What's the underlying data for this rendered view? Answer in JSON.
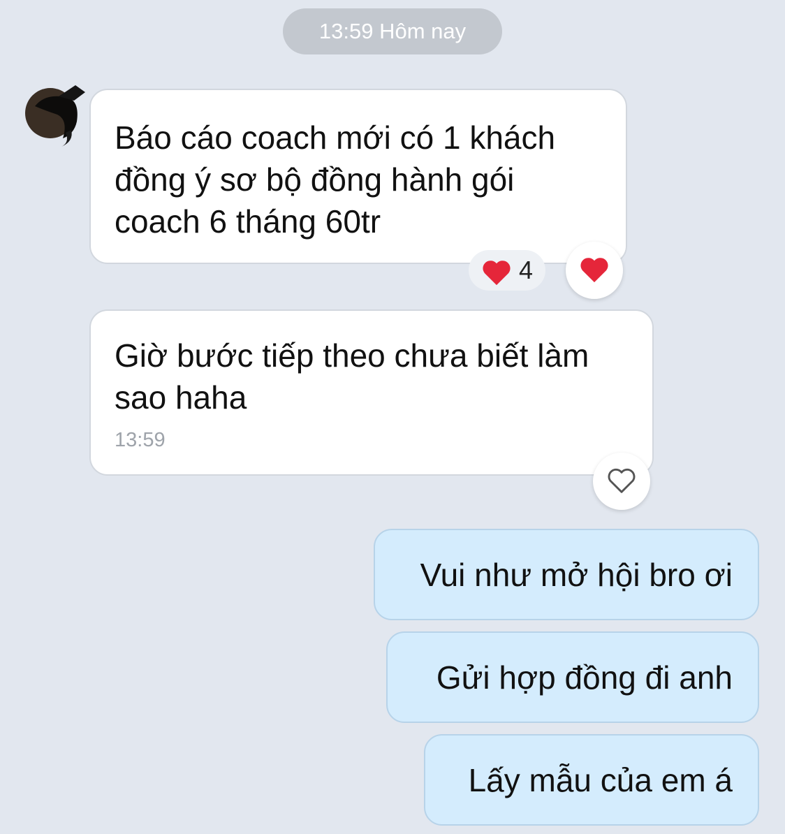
{
  "header": {
    "timestamp": "13:59 Hôm nay"
  },
  "messages": {
    "incoming": [
      {
        "text": "Báo cáo coach mới có 1 khách đồng ý sơ bộ đồng hành gói coach 6 tháng 60tr",
        "reaction_count": "4"
      },
      {
        "text": "Giờ bước tiếp theo chưa biết làm sao haha",
        "time": "13:59"
      }
    ],
    "outgoing": [
      {
        "text": "Vui như mở hội bro ơi"
      },
      {
        "text": "Gửi hợp đồng đi anh"
      },
      {
        "text": "Lấy mẫu của em á"
      }
    ]
  },
  "colors": {
    "background": "#e2e7ef",
    "incoming_bubble": "#ffffff",
    "outgoing_bubble": "#d4ecfd",
    "heart": "#e5263a"
  },
  "icons": {
    "reaction_filled": "heart-filled-icon",
    "reaction_empty": "heart-outline-icon"
  }
}
